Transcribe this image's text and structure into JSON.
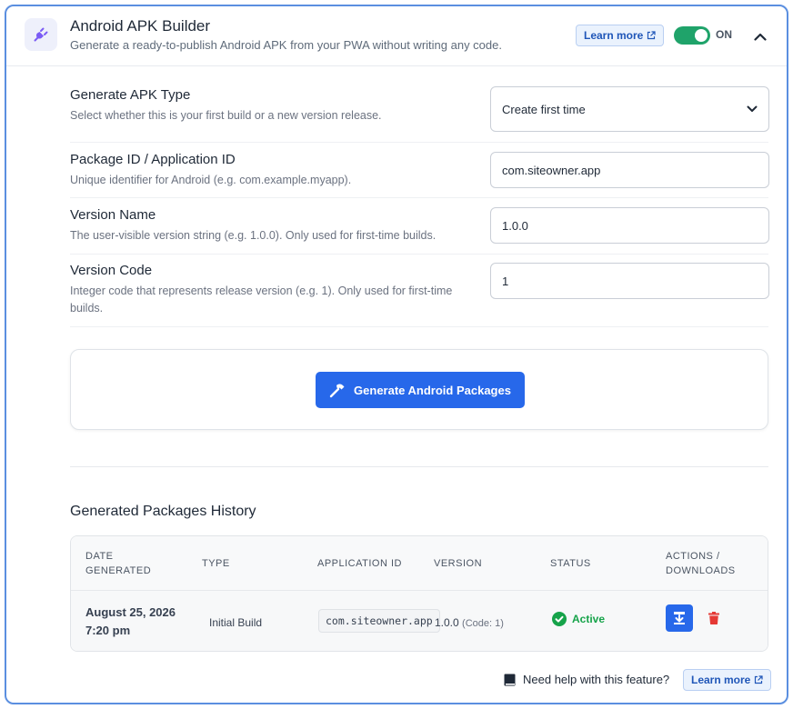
{
  "header": {
    "title": "Android APK Builder",
    "subtitle": "Generate a ready-to-publish Android APK from your PWA without writing any code.",
    "learn_more": "Learn more",
    "toggle_label": "ON",
    "toggle_on": true,
    "icon": "plug-icon"
  },
  "form": {
    "apk_type": {
      "label": "Generate APK Type",
      "hint": "Select whether this is your first build or a new version release.",
      "value": "Create first time"
    },
    "package_id": {
      "label": "Package ID / Application ID",
      "hint": "Unique identifier for Android (e.g. com.example.myapp).",
      "value": "com.siteowner.app"
    },
    "version_name": {
      "label": "Version Name",
      "hint": "The user-visible version string (e.g. 1.0.0). Only used for first-time builds.",
      "value": "1.0.0"
    },
    "version_code": {
      "label": "Version Code",
      "hint": "Integer code that represents release version (e.g. 1). Only used for first-time builds.",
      "value": "1"
    }
  },
  "generate_button": "Generate Android Packages",
  "history": {
    "title": "Generated Packages History",
    "columns": {
      "date": "DATE GENERATED",
      "type": "TYPE",
      "app_id": "APPLICATION ID",
      "version": "VERSION",
      "status": "STATUS",
      "actions": "ACTIONS / DOWNLOADS"
    },
    "rows": [
      {
        "date": "August 25, 2026",
        "time": "7:20 pm",
        "type": "Initial Build",
        "app_id": "com.siteowner.app",
        "version": "1.0.0",
        "version_code": "(Code: 1)",
        "status": "Active"
      }
    ]
  },
  "footer": {
    "help_text": "Need help with this feature?",
    "learn_more": "Learn more"
  },
  "colors": {
    "primary": "#2768ea",
    "success": "#16a34a",
    "danger": "#e53935",
    "accent": "#7b5cf5"
  }
}
